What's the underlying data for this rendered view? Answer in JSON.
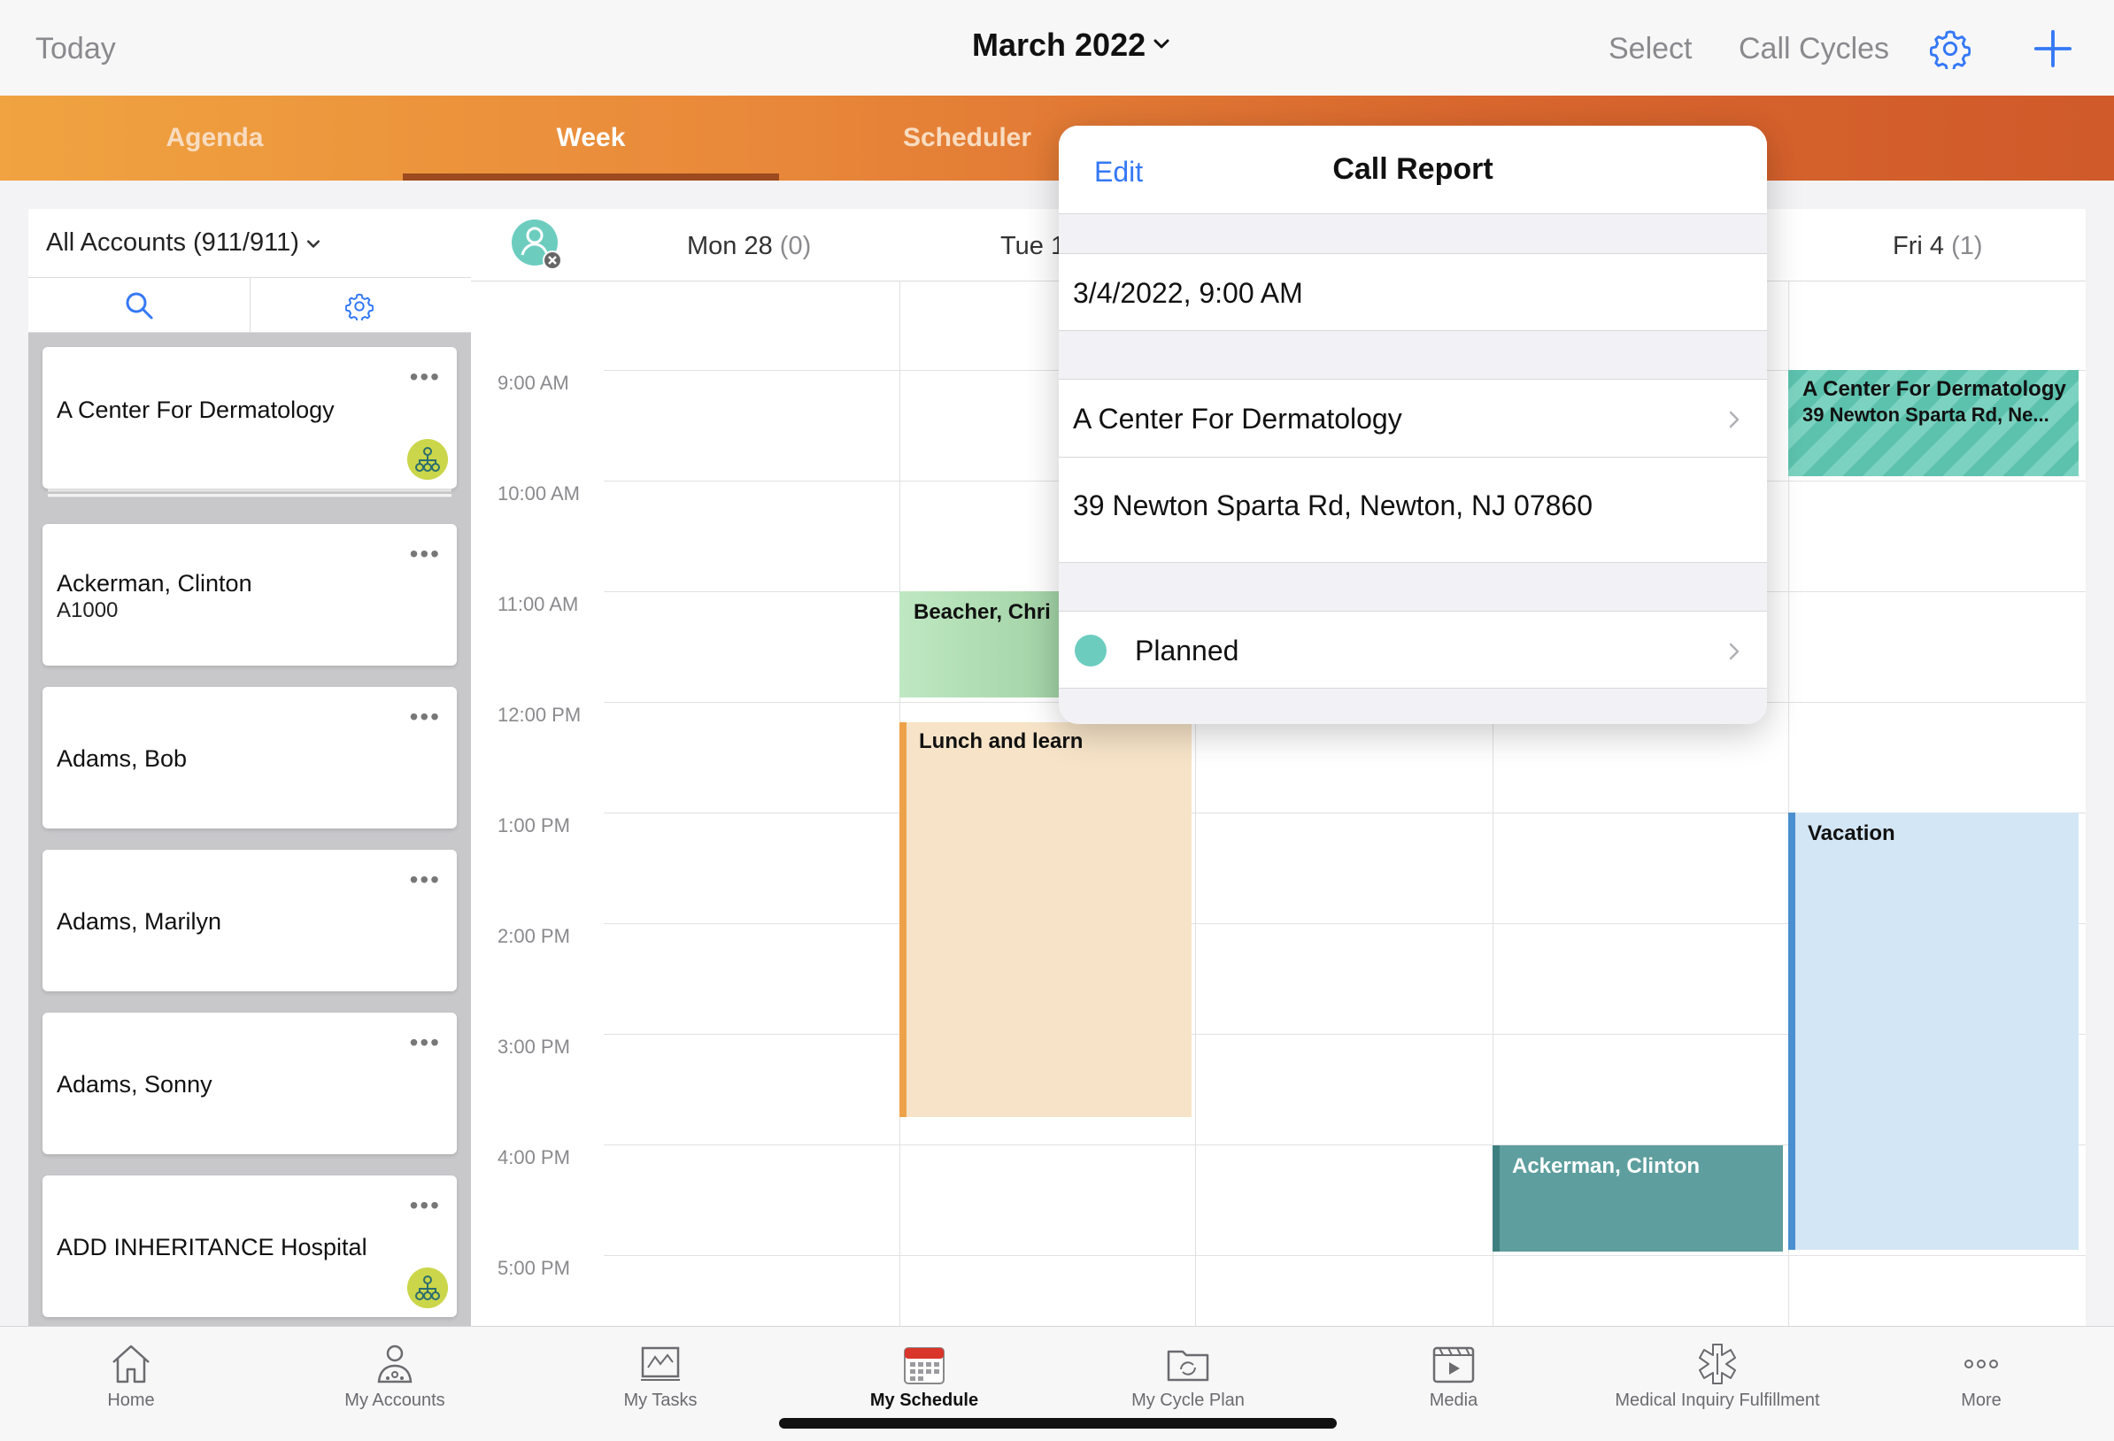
{
  "topbar": {
    "today": "Today",
    "month": "March 2022",
    "select": "Select",
    "call_cycles": "Call Cycles"
  },
  "tabs": [
    {
      "label": "Agenda",
      "active": false
    },
    {
      "label": "Week",
      "active": true
    },
    {
      "label": "Scheduler",
      "active": false
    }
  ],
  "accounts": {
    "filter": "All Accounts (911/911)",
    "items": [
      {
        "name": "A Center For Dermatology",
        "sub": "",
        "hierarchy": true
      },
      {
        "name": "Ackerman, Clinton",
        "sub": "A1000",
        "hierarchy": false
      },
      {
        "name": "Adams, Bob",
        "sub": "",
        "hierarchy": false
      },
      {
        "name": "Adams, Marilyn",
        "sub": "",
        "hierarchy": false
      },
      {
        "name": "Adams, Sonny",
        "sub": "",
        "hierarchy": false
      },
      {
        "name": "ADD INHERITANCE Hospital",
        "sub": "",
        "hierarchy": true
      }
    ]
  },
  "calendar": {
    "days": [
      {
        "label": "Mon 28",
        "count": "(0)"
      },
      {
        "label": "Tue 1",
        "count": ""
      },
      {
        "label": "Fri 4",
        "count": "(1)"
      }
    ],
    "times": [
      "9:00 AM",
      "10:00 AM",
      "11:00 AM",
      "12:00 PM",
      "1:00 PM",
      "2:00 PM",
      "3:00 PM",
      "4:00 PM",
      "5:00 PM"
    ],
    "events": {
      "beacher": "Beacher, Chri",
      "lunch": "Lunch and learn",
      "ackerman": "Ackerman, Clinton",
      "vacation": "Vacation",
      "acd_name": "A Center For Dermatology",
      "acd_addr": "39 Newton Sparta Rd, Ne..."
    }
  },
  "popover": {
    "edit": "Edit",
    "title": "Call Report",
    "datetime": "3/4/2022, 9:00 AM",
    "account": "A Center For Dermatology",
    "address": "39 Newton Sparta Rd, Newton, NJ 07860",
    "status": "Planned",
    "status_color": "#6ccdbf"
  },
  "bottom_nav": [
    {
      "label": "Home",
      "icon": "home-icon"
    },
    {
      "label": "My Accounts",
      "icon": "accounts-icon"
    },
    {
      "label": "My Tasks",
      "icon": "tasks-icon"
    },
    {
      "label": "My Schedule",
      "icon": "calendar-icon",
      "active": true
    },
    {
      "label": "My Cycle Plan",
      "icon": "cycle-plan-icon"
    },
    {
      "label": "Media",
      "icon": "media-icon"
    },
    {
      "label": "Medical Inquiry Fulfillment",
      "icon": "medical-icon"
    },
    {
      "label": "More",
      "icon": "more-icon"
    }
  ],
  "colors": {
    "accent": "#3478f6",
    "tab_gradient_start": "#f0a340",
    "tab_gradient_end": "#d05a2a"
  }
}
